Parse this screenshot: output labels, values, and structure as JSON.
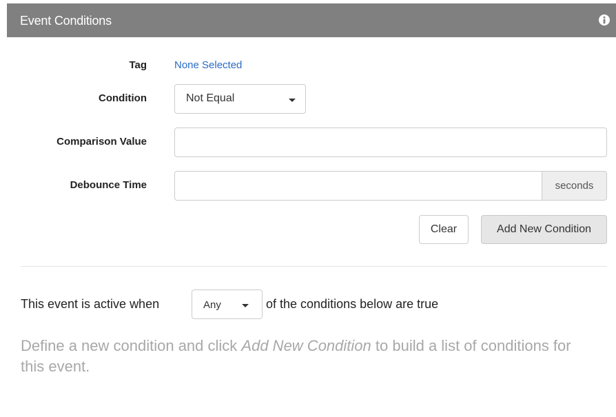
{
  "header": {
    "title": "Event Conditions",
    "info_icon": "info-circle-icon"
  },
  "form": {
    "tag": {
      "label": "Tag",
      "value": "None Selected"
    },
    "condition": {
      "label": "Condition",
      "selected": "Not Equal"
    },
    "comparison_value": {
      "label": "Comparison Value",
      "value": ""
    },
    "debounce_time": {
      "label": "Debounce Time",
      "value": "",
      "unit": "seconds"
    },
    "buttons": {
      "clear": "Clear",
      "add": "Add New Condition"
    }
  },
  "summary": {
    "prefix": "This event is active when",
    "mode_selected": "Any",
    "suffix": "of the conditions below are true"
  },
  "hint": {
    "part1": "Define a new condition and click",
    "emphasis": "Add New Condition",
    "part2": "to build a list of conditions for this event."
  },
  "colors": {
    "header_bg": "#808080",
    "link": "#2a6bc4",
    "hint_text": "#a8a8a8"
  }
}
